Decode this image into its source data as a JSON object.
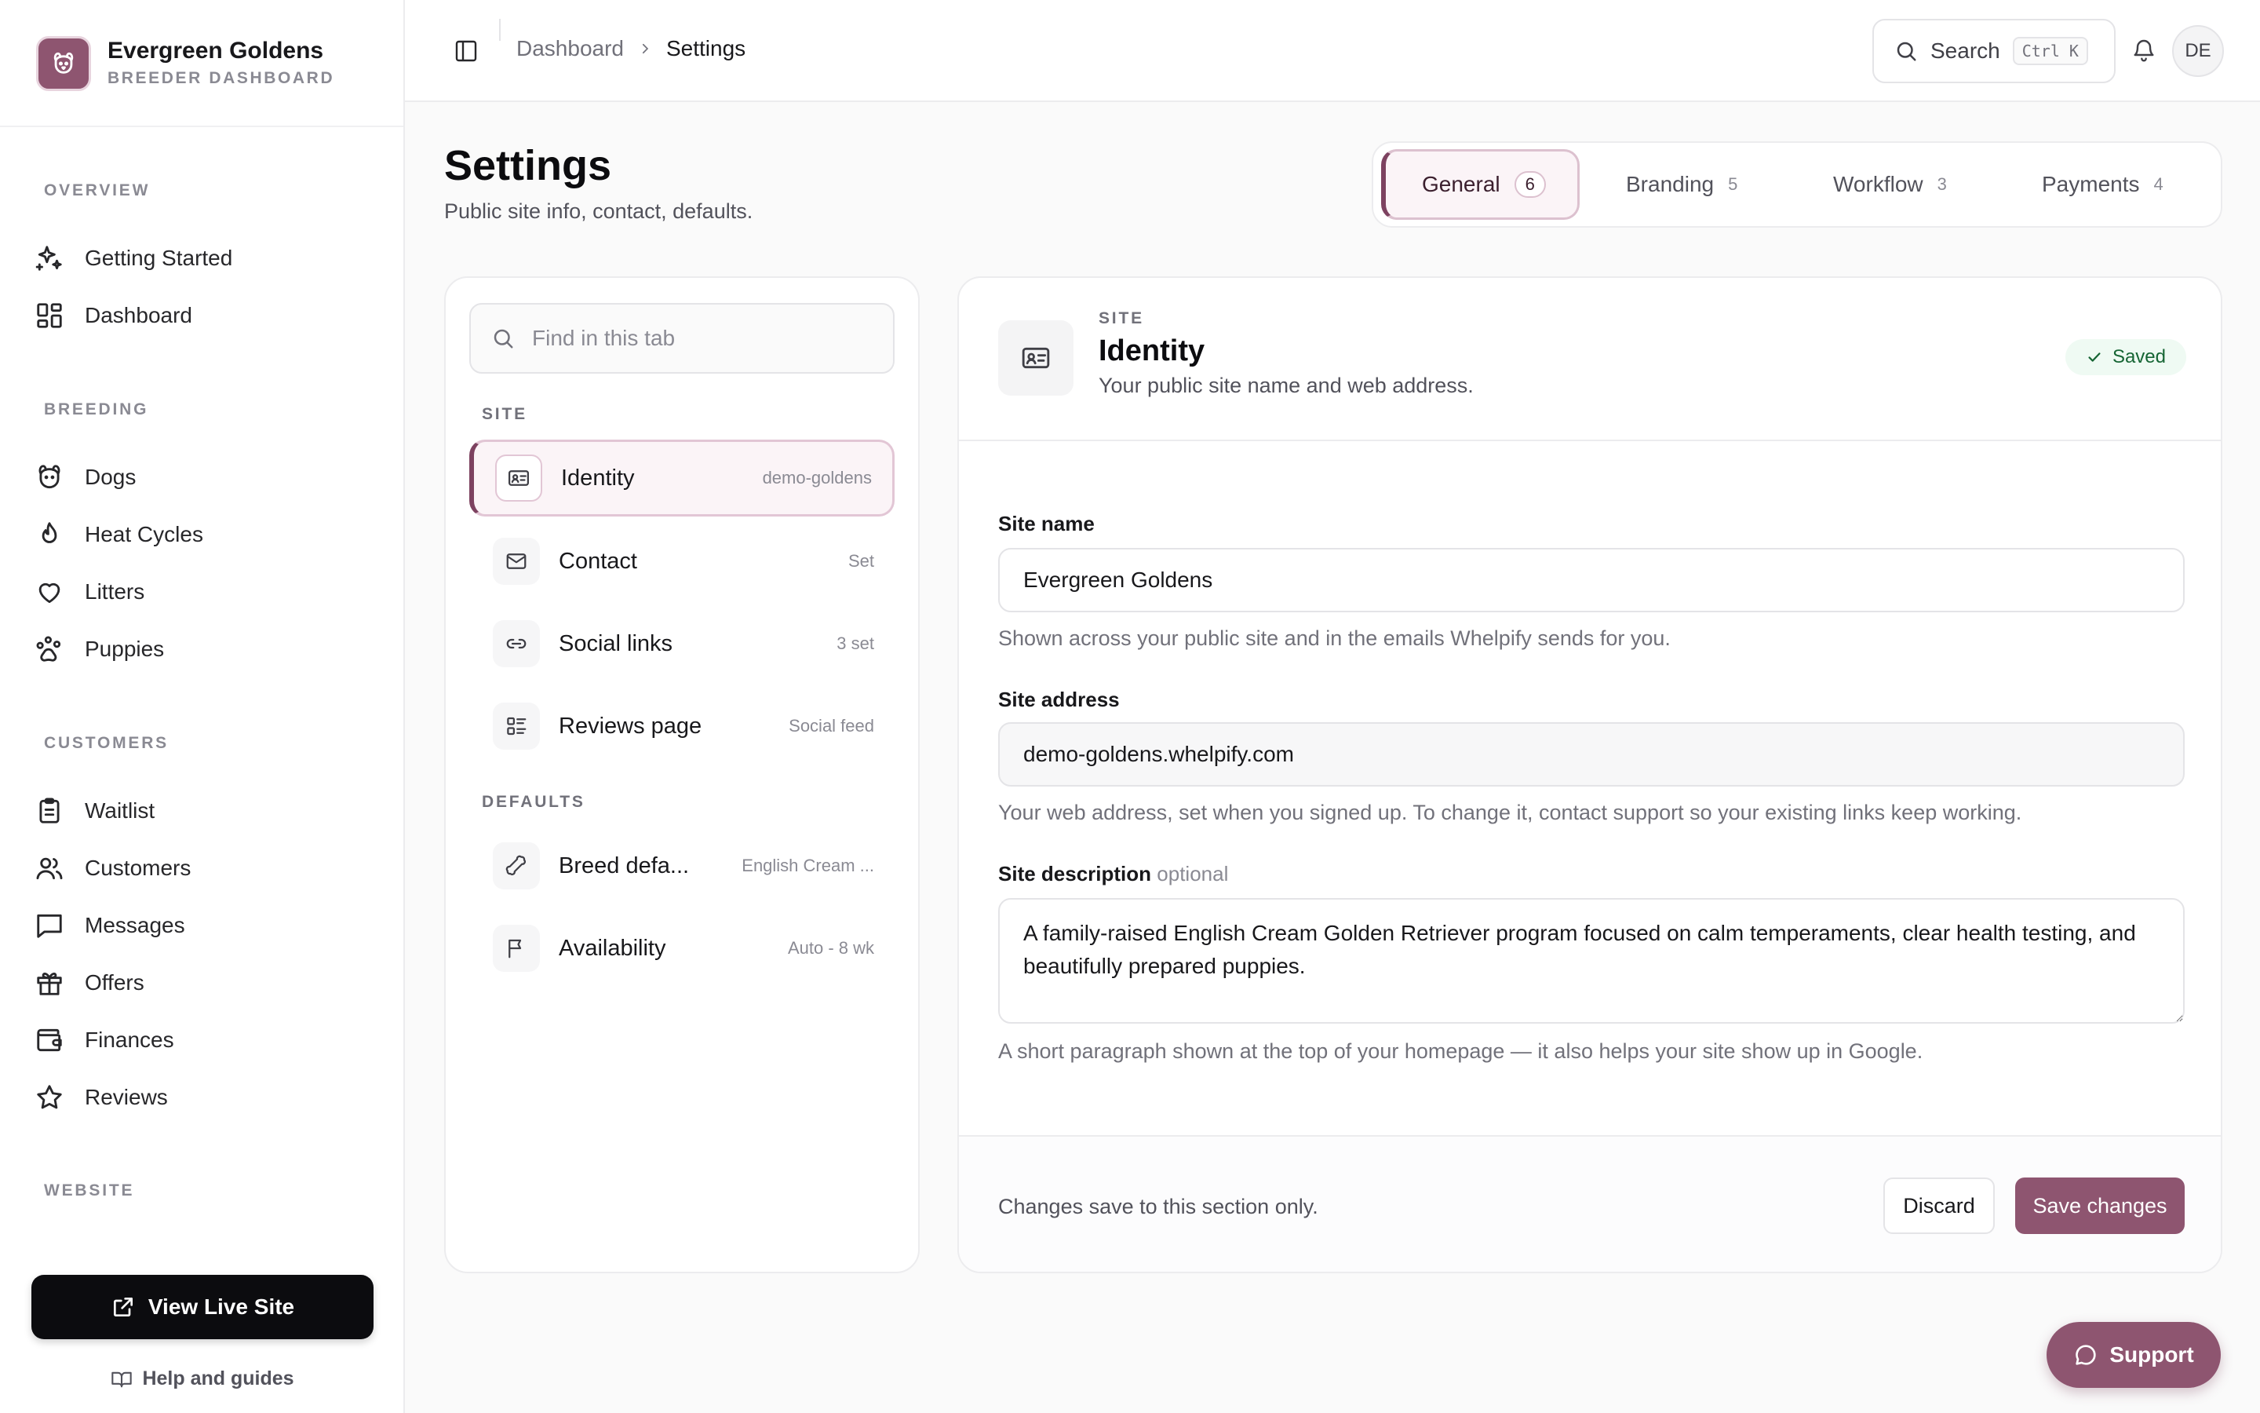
{
  "brand": {
    "name": "Evergreen Goldens",
    "subtitle": "BREEDER DASHBOARD",
    "accent": "#8e5570"
  },
  "sidebar": {
    "sections": [
      {
        "title": "OVERVIEW",
        "items": [
          {
            "label": "Getting Started",
            "icon": "sparkles-icon"
          },
          {
            "label": "Dashboard",
            "icon": "grid-icon"
          }
        ]
      },
      {
        "title": "BREEDING",
        "items": [
          {
            "label": "Dogs",
            "icon": "dog-icon"
          },
          {
            "label": "Heat Cycles",
            "icon": "flame-icon"
          },
          {
            "label": "Litters",
            "icon": "heart-icon"
          },
          {
            "label": "Puppies",
            "icon": "paw-icon"
          }
        ]
      },
      {
        "title": "CUSTOMERS",
        "items": [
          {
            "label": "Waitlist",
            "icon": "clipboard-icon"
          },
          {
            "label": "Customers",
            "icon": "users-icon"
          },
          {
            "label": "Messages",
            "icon": "message-icon"
          },
          {
            "label": "Offers",
            "icon": "gift-icon"
          },
          {
            "label": "Finances",
            "icon": "wallet-icon"
          },
          {
            "label": "Reviews",
            "icon": "star-icon"
          }
        ]
      },
      {
        "title": "WEBSITE",
        "items": []
      }
    ],
    "live_button": "View Live Site",
    "help_link": "Help and guides"
  },
  "topbar": {
    "breadcrumb": [
      "Dashboard",
      "Settings"
    ],
    "search_label": "Search",
    "search_shortcut": "Ctrl K",
    "avatar_initials": "DE"
  },
  "page": {
    "title": "Settings",
    "subtitle": "Public site info, contact, defaults."
  },
  "tabs": [
    {
      "label": "General",
      "count": "6",
      "active": true
    },
    {
      "label": "Branding",
      "count": "5",
      "active": false
    },
    {
      "label": "Workflow",
      "count": "3",
      "active": false
    },
    {
      "label": "Payments",
      "count": "4",
      "active": false
    }
  ],
  "left_panel": {
    "search_placeholder": "Find in this tab",
    "sections": [
      {
        "title": "SITE",
        "items": [
          {
            "label": "Identity",
            "meta": "demo-goldens",
            "icon": "id-card-icon",
            "active": true
          },
          {
            "label": "Contact",
            "meta": "Set",
            "icon": "mail-icon",
            "active": false
          },
          {
            "label": "Social links",
            "meta": "3 set",
            "icon": "link-icon",
            "active": false
          },
          {
            "label": "Reviews page",
            "meta": "Social feed",
            "icon": "list-icon",
            "active": false
          }
        ]
      },
      {
        "title": "DEFAULTS",
        "items": [
          {
            "label": "Breed defa...",
            "meta": "English Cream ...",
            "icon": "bone-icon",
            "active": false
          },
          {
            "label": "Availability",
            "meta": "Auto - 8 wk",
            "icon": "flag-icon",
            "active": false
          }
        ]
      }
    ]
  },
  "card": {
    "eyebrow": "SITE",
    "title": "Identity",
    "description": "Your public site name and web address.",
    "status": "Saved",
    "fields": {
      "site_name": {
        "label": "Site name",
        "value": "Evergreen Goldens",
        "help": "Shown across your public site and in the emails Whelpify sends for you."
      },
      "site_address": {
        "label": "Site address",
        "value": "demo-goldens.whelpify.com",
        "help": "Your web address, set when you signed up. To change it, contact support so your existing links keep working."
      },
      "site_description": {
        "label": "Site description",
        "optional": "optional",
        "value": "A family-raised English Cream Golden Retriever program focused on calm temperaments, clear health testing, and beautifully prepared puppies.",
        "help": "A short paragraph shown at the top of your homepage — it also helps your site show up in Google."
      }
    },
    "footer_note": "Changes save to this section only.",
    "discard_label": "Discard",
    "save_label": "Save changes"
  },
  "support_label": "Support"
}
